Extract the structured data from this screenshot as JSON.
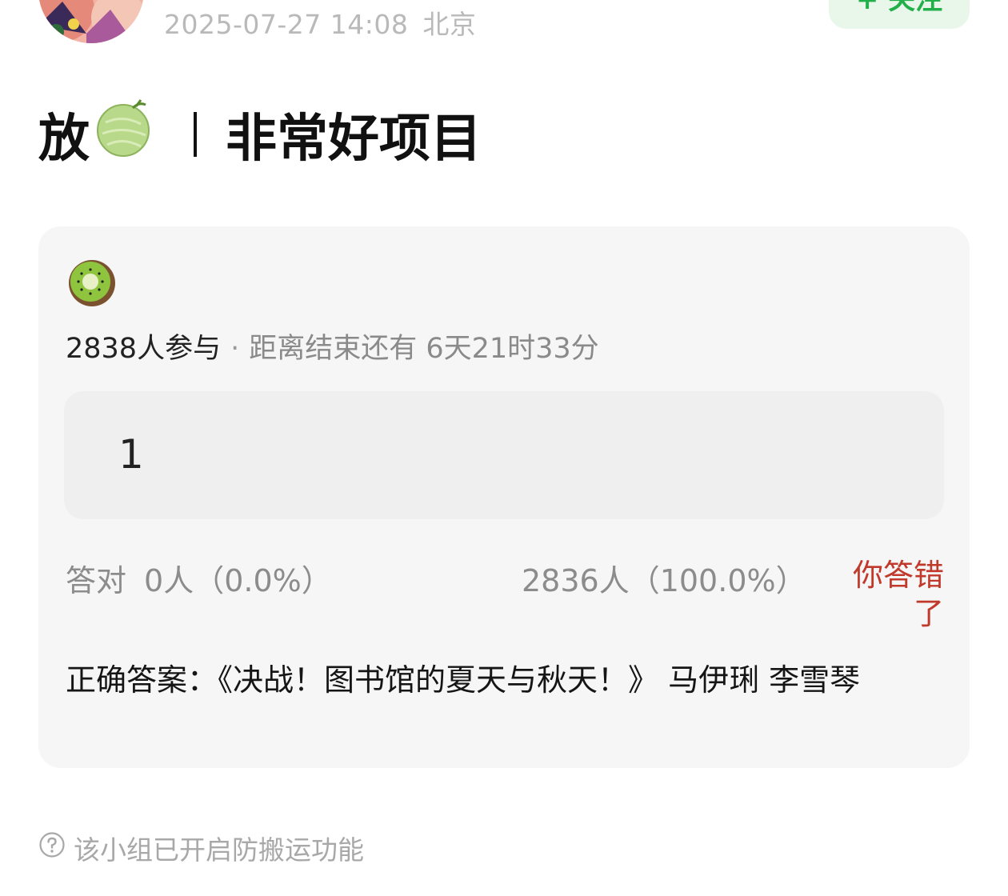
{
  "header": {
    "meta_text": "2025-07-27 14:08",
    "location": "北京",
    "follow_label": "+ 关注"
  },
  "post": {
    "title_prefix": "放",
    "title_text": "非常好项目",
    "title_icon": "melon-icon"
  },
  "quiz": {
    "question_icon": "kiwi-icon",
    "participants": "2838人参与",
    "separator": "·",
    "remaining": "距离结束还有 6天21时33分",
    "user_answer": "1",
    "correct_label": "答对",
    "correct_stat": "0人（0.0%）",
    "wrong_stat": "2836人（100.0%）",
    "result_message": "你答错了",
    "correct_answer": "正确答案：《决战！图书馆的夏天与秋天！》 马伊琍 李雪琴"
  },
  "footer": {
    "notice": "该小组已开启防搬运功能",
    "notice_icon": "help-circle-icon"
  },
  "colors": {
    "accent_green": "#23b04a",
    "wrong_red": "#c0392b",
    "card_bg": "#f6f6f6"
  }
}
